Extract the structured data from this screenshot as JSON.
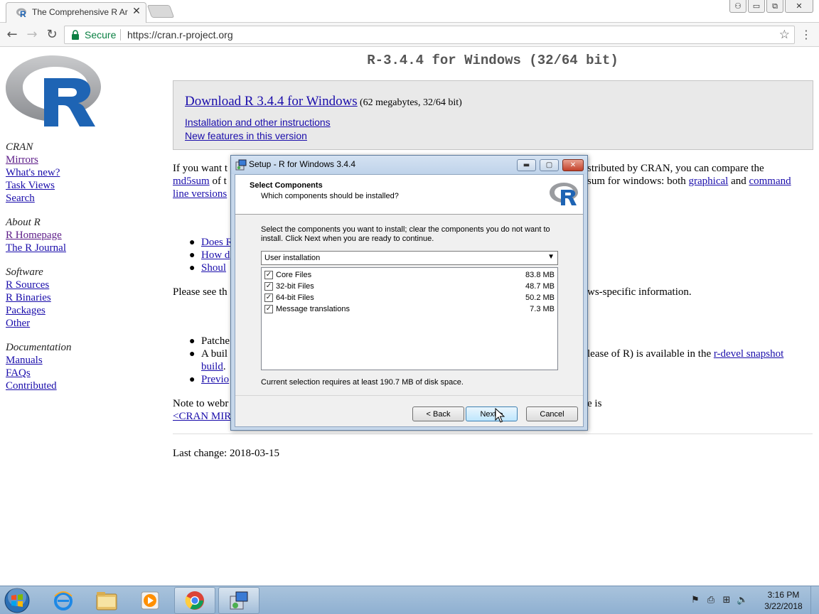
{
  "browser": {
    "tab_title": "The Comprehensive R Ar",
    "secure_label": "Secure",
    "url": "https://cran.r-project.org"
  },
  "page": {
    "title": "R-3.4.4 for Windows (32/64 bit)",
    "download": {
      "main_link": "Download R 3.4.4 for Windows",
      "main_meta": "(62 megabytes, 32/64 bit)",
      "install_link": "Installation and other instructions",
      "features_link": "New features in this version"
    },
    "sidebar": {
      "cran_heading": "CRAN",
      "cran_links": [
        "Mirrors",
        "What's new?",
        "Task Views",
        "Search"
      ],
      "about_heading": "About R",
      "about_links": [
        "R Homepage",
        "The R Journal"
      ],
      "software_heading": "Software",
      "software_links": [
        "R Sources",
        "R Binaries",
        "Packages",
        "Other"
      ],
      "doc_heading": "Documentation",
      "doc_links": [
        "Manuals",
        "FAQs",
        "Contributed"
      ]
    },
    "body": {
      "p1_start": "If you want t",
      "p1_end": "stributed by CRAN, you can compare the",
      "p1_l2_link": "md5sum",
      "p1_l2_mid": " of t",
      "p1_l2_end_text": "sum for windows: both ",
      "p1_l2_graphical": "graphical",
      "p1_l2_and": " and ",
      "p1_l2_command": "command",
      "p1_l3_link": "line versions",
      "q_items": [
        "Does R",
        "How d",
        "Shoul"
      ],
      "p2_start": "Please see th",
      "p2_end": "ws-specific information.",
      "patch_items": [
        "Patche",
        "A buil",
        "Previo"
      ],
      "patch2_end": "lease of R) is available in the ",
      "patch2_link": "r-devel snapshot",
      "patch2_l2_link": "build",
      "patch2_l2_end": ".",
      "note_start": "Note to webr",
      "note_end": "e is",
      "note_link": "<CRAN MIR",
      "last_change": "Last change: 2018-03-15"
    }
  },
  "dialog": {
    "title": "Setup - R for Windows 3.4.4",
    "heading": "Select Components",
    "subheading": "Which components should be installed?",
    "description": "Select the components you want to install; clear the components you do not want to install. Click Next when you are ready to continue.",
    "install_type": "User installation",
    "components": [
      {
        "name": "Core Files",
        "size": "83.8 MB",
        "checked": true
      },
      {
        "name": "32-bit Files",
        "size": "48.7 MB",
        "checked": true
      },
      {
        "name": "64-bit Files",
        "size": "50.2 MB",
        "checked": true
      },
      {
        "name": "Message translations",
        "size": "7.3 MB",
        "checked": true
      }
    ],
    "requirement": "Current selection requires at least 190.7 MB of disk space.",
    "back_label": "< Back",
    "next_label": "Next >",
    "cancel_label": "Cancel"
  },
  "taskbar": {
    "time": "3:16 PM",
    "date": "3/22/2018"
  },
  "colors": {
    "link": "#1a0dab",
    "visited": "#5b1a87",
    "secure_green": "#0b8043",
    "r_blue": "#1e64b4"
  }
}
